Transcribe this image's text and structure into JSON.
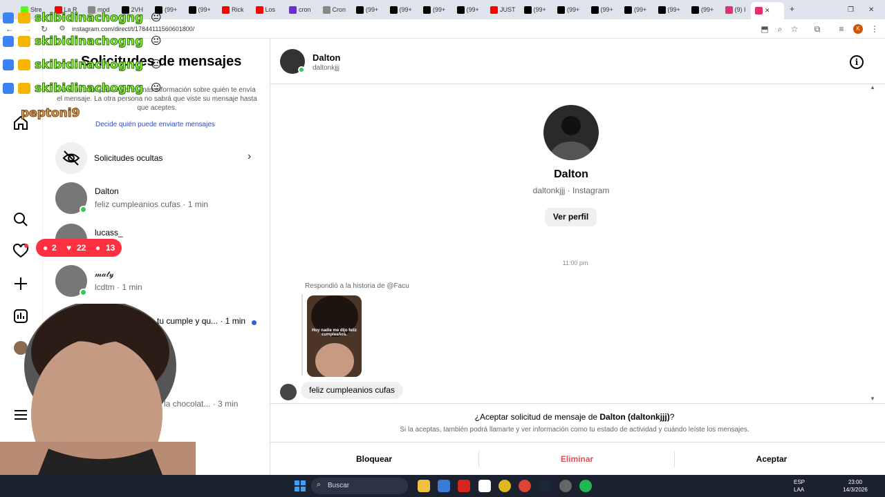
{
  "browser": {
    "tabs": [
      {
        "label": "Stre",
        "color": "#53fc18"
      },
      {
        "label": "La R",
        "color": "#ff0000"
      },
      {
        "label": "mod",
        "color": "#888888"
      },
      {
        "label": "2VH",
        "color": "#000000"
      },
      {
        "label": "(99+",
        "color": "#000000"
      },
      {
        "label": "(99+",
        "color": "#000000"
      },
      {
        "label": "Rick",
        "color": "#ff0000"
      },
      {
        "label": "Los",
        "color": "#ff0000"
      },
      {
        "label": "cron",
        "color": "#6b2fd0"
      },
      {
        "label": "Cron",
        "color": "#888888"
      },
      {
        "label": "(99+",
        "color": "#000000"
      },
      {
        "label": "(99+",
        "color": "#000000"
      },
      {
        "label": "(99+",
        "color": "#000000"
      },
      {
        "label": "(99+",
        "color": "#000000"
      },
      {
        "label": "JUST",
        "color": "#ff0000"
      },
      {
        "label": "(99+",
        "color": "#000000"
      },
      {
        "label": "(99+",
        "color": "#000000"
      },
      {
        "label": "(99+",
        "color": "#000000"
      },
      {
        "label": "(99+",
        "color": "#000000"
      },
      {
        "label": "(99+",
        "color": "#000000"
      },
      {
        "label": "(99+",
        "color": "#000000"
      },
      {
        "label": "(9) I",
        "color": "#e1306c"
      }
    ],
    "url": "instagram.com/direct/t/17844111560601800/",
    "profile_initial": "K"
  },
  "stream_chat": [
    {
      "user": "skibidinachogng",
      "msg": "😐"
    },
    {
      "user": "skibidinachogng",
      "msg": "😐"
    },
    {
      "user": "skibidinachogng",
      "msg": "😐"
    },
    {
      "user": "skibidinachogng",
      "msg": "😐"
    },
    {
      "user": "peptoni9",
      "msg": ""
    }
  ],
  "notifications": {
    "comments": "2",
    "likes": "22",
    "follows": "13"
  },
  "panel": {
    "title": "Solicitudes de mensajes",
    "info": "Abre un chat para obtener más información sobre quién te envía el mensaje. La otra persona no sabrá que viste su mensaje hasta que aceptes.",
    "link": "Decide quién puede enviarte mensajes",
    "hidden_requests": "Solicitudes ocultas",
    "requests": [
      {
        "name": "Dalton",
        "preview": "feliz cumpleanios cufas · 1 min",
        "online": true,
        "unread": false
      },
      {
        "name": "lucass_",
        "preview": "· 1 min",
        "online": false,
        "unread": false
      },
      {
        "name": "𝓂𝒶𝓉𝓎",
        "preview": "lcdtm · 1 min",
        "online": true,
        "unread": false
      },
      {
        "name": "",
        "preview": "tu cumple y qu... · 1 min",
        "online": false,
        "unread": true
      },
      {
        "name": "",
        "preview": "a la chocolat... · 3 min",
        "online": false,
        "unread": false
      }
    ]
  },
  "conversation": {
    "name": "Dalton",
    "username": "daltonkjjj",
    "profile_sub": "daltonkjjj · Instagram",
    "view_profile": "Ver perfil",
    "time": "11:00 pm",
    "story_reply": "Respondió a la historia de @Facu",
    "story_text": "Hoy nadie me dijo feliz cumpleaños.",
    "message": "feliz cumpleanios cufas",
    "accept_prefix": "¿Aceptar solicitud de mensaje de ",
    "accept_bold": "Dalton (daltonkjjj)",
    "accept_suffix": "?",
    "accept_note": "Si la aceptas, también podrá llamarte y ver información como tu estado de actividad y cuándo leíste los mensajes.",
    "block": "Bloquear",
    "delete": "Eliminar",
    "accept": "Aceptar"
  },
  "taskbar": {
    "search": "Buscar",
    "lang": "ESP",
    "lang2": "LAA",
    "time": "23:00",
    "date": "14/3/2026"
  },
  "colors": {
    "accent": "#0095f6",
    "danger": "#ed4956",
    "link": "#2f4bd0"
  }
}
